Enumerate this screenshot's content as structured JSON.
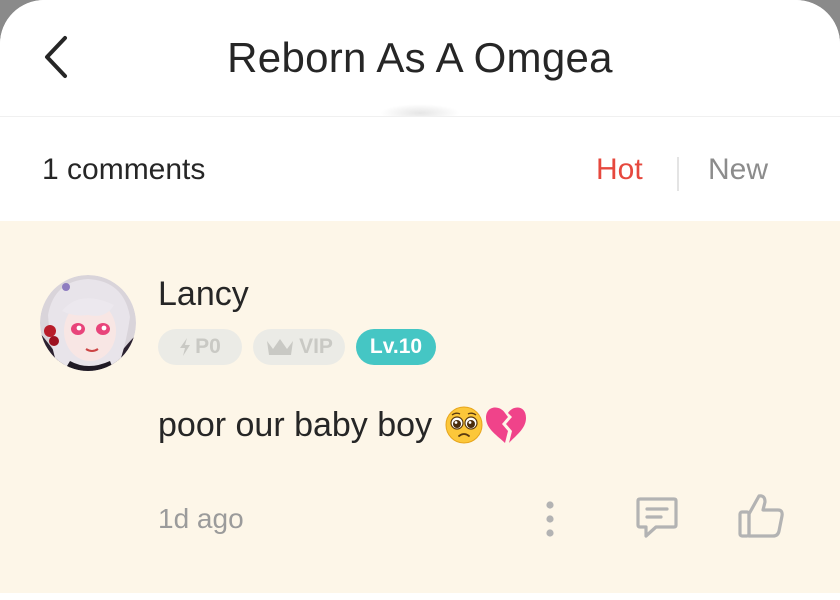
{
  "header": {
    "title": "Reborn As A Omgea",
    "back_icon": "chevron-left-icon"
  },
  "comments_bar": {
    "count_label": "1 comments",
    "sort_hot": "Hot",
    "sort_new": "New",
    "active_sort": "Hot",
    "colors": {
      "active": "#e6483e",
      "inactive": "#8c8c8c"
    }
  },
  "comment": {
    "username": "Lancy",
    "badges": {
      "po": "P0",
      "vip": "VIP",
      "level": "Lv.10"
    },
    "text": "poor our baby boy",
    "emojis": [
      "pleading-face-icon",
      "broken-heart-icon"
    ],
    "timestamp": "1d ago",
    "actions": [
      "more-icon",
      "reply-icon",
      "like-icon"
    ],
    "colors": {
      "card_bg": "#fdf6e8",
      "level_badge": "#45c6c4"
    }
  }
}
